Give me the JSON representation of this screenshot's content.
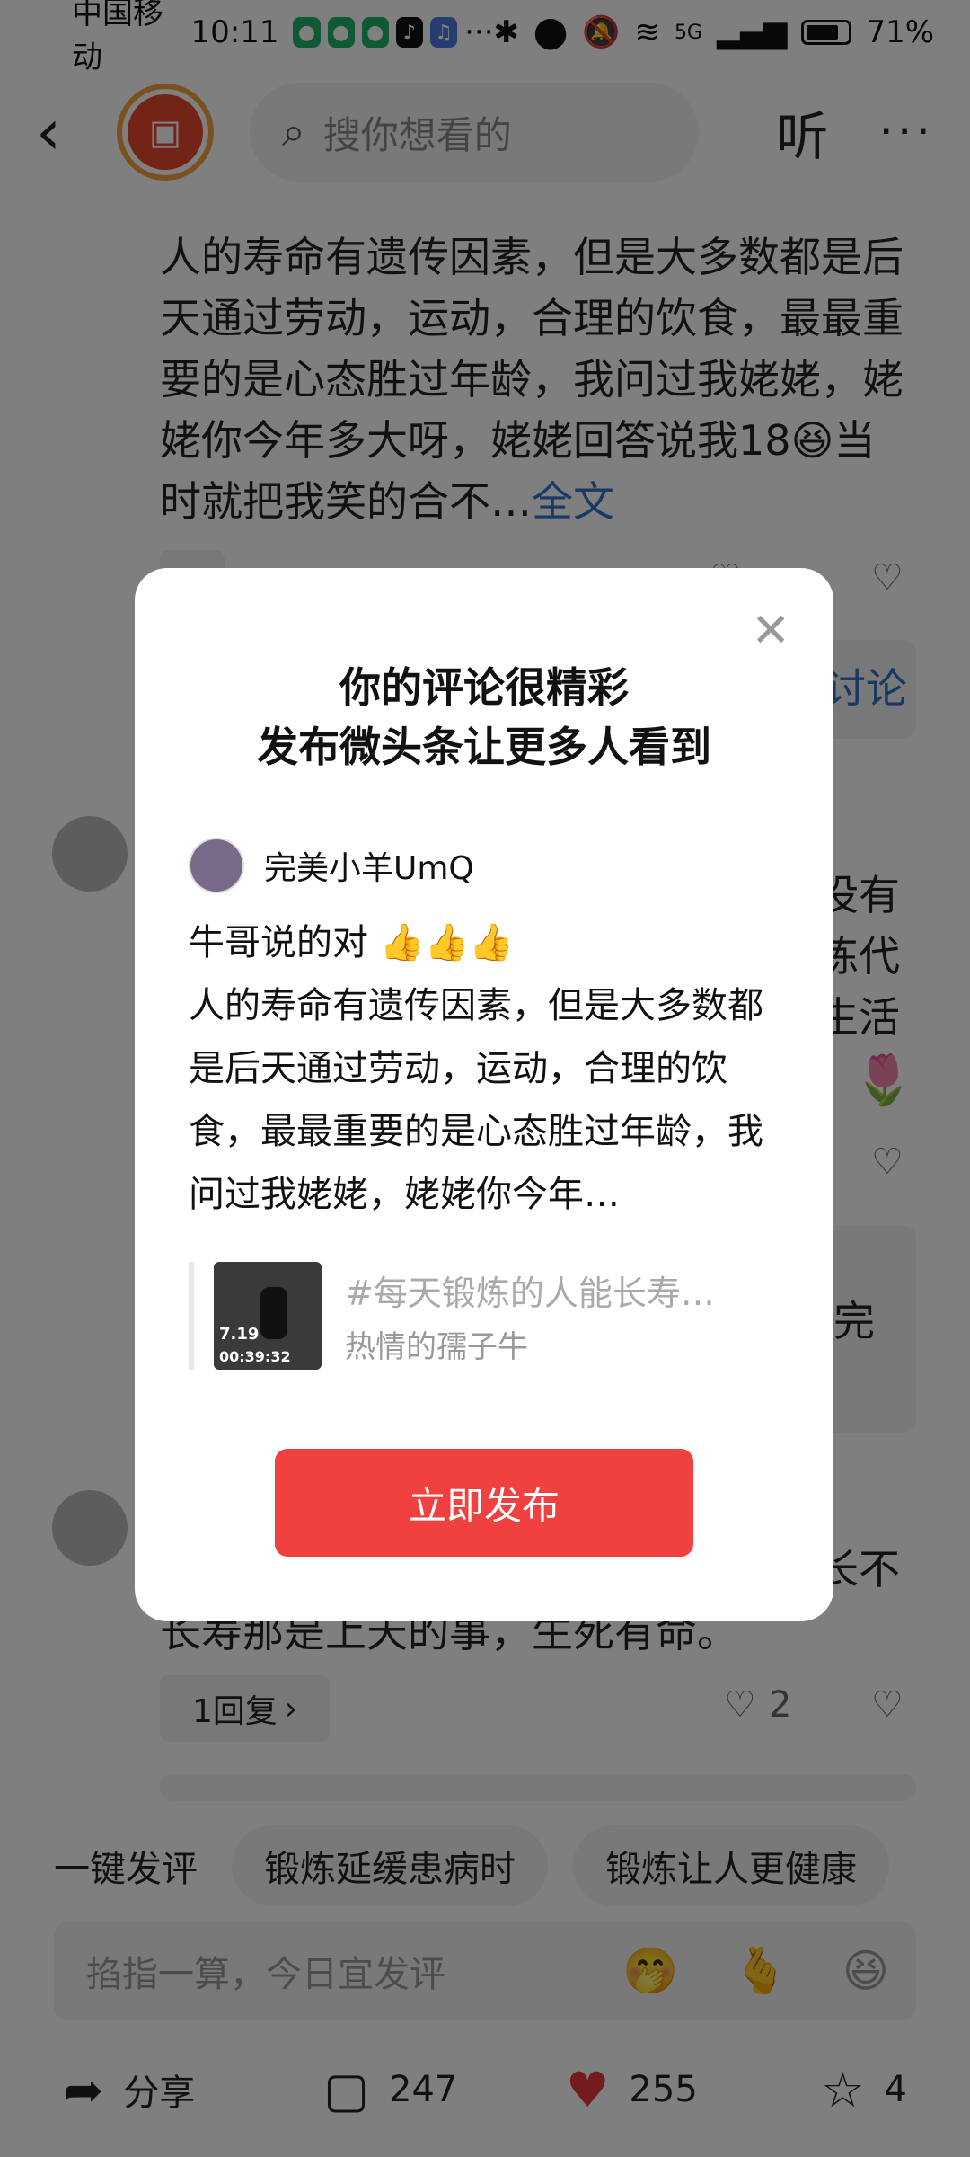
{
  "status_bar": {
    "carrier": "中国移动",
    "time": "10:11",
    "network": "5G",
    "battery": "71%"
  },
  "top_nav": {
    "search_placeholder": "搜你想看的",
    "listen_label": "听"
  },
  "background": {
    "first_comment_text": "人的寿命有遗传因素，但是大多数都是后天通过劳动，运动，合理的饮食，最最重要的是心态胜过年龄，我问过我姥姥，姥姥你今年多大呀，姥姥回答说我18😆当时就把我笑的合不…",
    "full_text_link": "全文",
    "snippet_discuss": "讨论",
    "snippet_1": "没有",
    "snippet_2": "练代",
    "snippet_3": "生活",
    "snippet_4": "完",
    "snippet_5": "长不",
    "third_comment_text": "长寿那是上天的事，生死有命。",
    "reply_count_label": "1回复",
    "like_count": "2"
  },
  "chips": {
    "label": "一键发评",
    "items": [
      "锻炼延缓患病时",
      "锻炼让人更健康"
    ]
  },
  "input": {
    "placeholder": "掐指一算，今日宜发评"
  },
  "action_bar": {
    "share_label": "分享",
    "comment_count": "247",
    "like_count": "255",
    "favorite_count": "4"
  },
  "modal": {
    "title_line1": "你的评论很精彩",
    "title_line2": "发布微头条让更多人看到",
    "author_name": "完美小羊UmQ",
    "comment_first_line": "牛哥说的对",
    "comment_body": "人的寿命有遗传因素，但是大多数都是后天通过劳动，运动，合理的饮食，最最重要的是心态胜过年龄，我问过我姥姥，姥姥你今年…",
    "quote_title": "#每天锻炼的人能长寿…",
    "quote_author": "热情的孺子牛",
    "thumb_distance": "7.19",
    "thumb_duration": "00:39:32",
    "publish_button": "立即发布"
  }
}
